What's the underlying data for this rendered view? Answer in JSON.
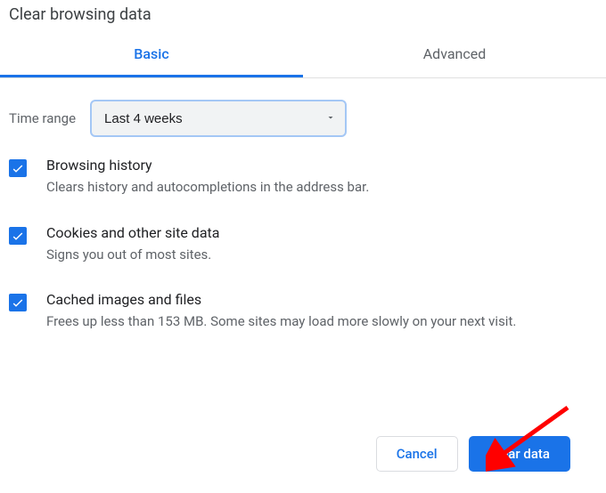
{
  "title": "Clear browsing data",
  "tabs": {
    "basic": "Basic",
    "advanced": "Advanced"
  },
  "time": {
    "label": "Time range",
    "selected": "Last 4 weeks"
  },
  "options": [
    {
      "title": "Browsing history",
      "desc": "Clears history and autocompletions in the address bar."
    },
    {
      "title": "Cookies and other site data",
      "desc": "Signs you out of most sites."
    },
    {
      "title": "Cached images and files",
      "desc": "Frees up less than 153 MB. Some sites may load more slowly on your next visit."
    }
  ],
  "buttons": {
    "cancel": "Cancel",
    "clear": "Clear data"
  }
}
